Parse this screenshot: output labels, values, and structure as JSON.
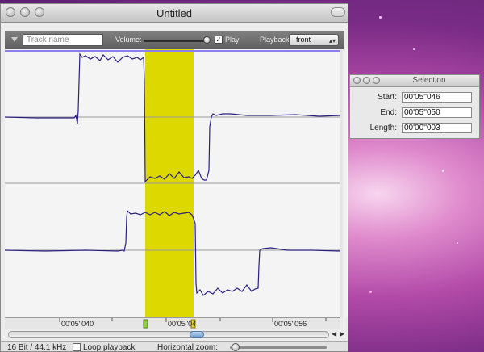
{
  "window": {
    "title": "Untitled",
    "toolbar": {
      "track_name_placeholder": "Track name",
      "volume_label": "Volume:",
      "volume_level": 0.95,
      "play_label": "Play",
      "play_checked": true,
      "playback_label": "Playback:",
      "playback_value": "front"
    },
    "ruler": {
      "labels": [
        "00'05''040",
        "00'05''04",
        "00'05''056"
      ]
    },
    "status": {
      "format": "16 Bit / 44.1 kHz",
      "loop_label": "Loop playback",
      "loop_checked": false,
      "zoom_label": "Horizontal zoom:",
      "zoom_level": 0.05
    }
  },
  "selection_window": {
    "title": "Selection",
    "start_label": "Start:",
    "start_value": "00'05''046",
    "end_label": "End:",
    "end_value": "00'05''050",
    "length_label": "Length:",
    "length_value": "00'00''003"
  },
  "colors": {
    "selection_highlight": "#dcd800",
    "waveform": "#2b2080",
    "play_head": "#8b7ff0"
  }
}
